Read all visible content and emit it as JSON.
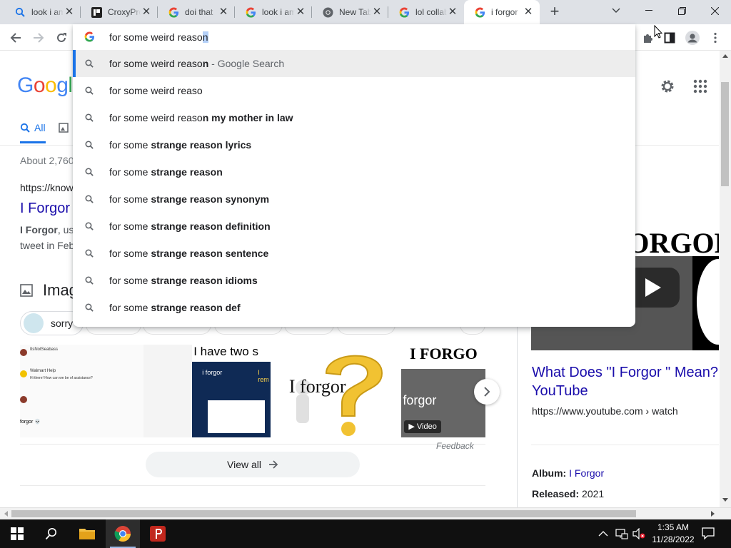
{
  "tabs": [
    {
      "title": "look i am",
      "icon": "google-search-icon",
      "active": false
    },
    {
      "title": "CroxyProxy",
      "icon": "croxyproxy-icon",
      "active": false
    },
    {
      "title": "doi that",
      "icon": "google-g-icon",
      "active": false
    },
    {
      "title": "look i am",
      "icon": "google-g-icon",
      "active": false
    },
    {
      "title": "New Tab",
      "icon": "chrome-icon",
      "active": false
    },
    {
      "title": "lol collab",
      "icon": "google-g-icon",
      "active": false
    },
    {
      "title": "i forgor",
      "icon": "google-g-icon",
      "active": true
    }
  ],
  "omnibox": {
    "typed": "for some weird reaso",
    "autocomplete": "n",
    "suggestions": [
      {
        "plain": "for some weird reaso",
        "bold": "n",
        "rest": "",
        "suffix": " - Google Search",
        "selected": true
      },
      {
        "plain": "for some weird reaso",
        "bold": "",
        "rest": "",
        "suffix": "",
        "selected": false
      },
      {
        "plain": "for some weird reaso",
        "bold": "n my mother in law",
        "rest": "",
        "suffix": "",
        "selected": false
      },
      {
        "plain": "for some ",
        "bold": "strange r",
        "rest": "eason lyrics",
        "suffix": "",
        "selected": false,
        "boldRest": true
      },
      {
        "plain": "for some ",
        "bold": "strange r",
        "rest": "eason",
        "suffix": "",
        "selected": false,
        "boldRest": true
      },
      {
        "plain": "for some ",
        "bold": "strange r",
        "rest": "eason synonym",
        "suffix": "",
        "selected": false,
        "boldRest": true
      },
      {
        "plain": "for some ",
        "bold": "strange r",
        "rest": "eason definition",
        "suffix": "",
        "selected": false,
        "boldRest": true
      },
      {
        "plain": "for some ",
        "bold": "strange r",
        "rest": "eason sentence",
        "suffix": "",
        "selected": false,
        "boldRest": true
      },
      {
        "plain": "for some ",
        "bold": "strange r",
        "rest": "eason idioms",
        "suffix": "",
        "selected": false,
        "boldRest": true
      },
      {
        "plain": "for some ",
        "bold": "strange r",
        "rest": "eason def",
        "suffix": "",
        "selected": false,
        "boldRest": true
      }
    ]
  },
  "page": {
    "logo_visible": "Googl",
    "nav_all": "All",
    "result_stats": "About 2,760",
    "result_cite": "https://know",
    "result_title": "I Forgor",
    "snippet_line1_bold": "I Forgor",
    "snippet_line1": ", us",
    "snippet_line2": "tweet in Feb",
    "images_heading": "Imag",
    "chip_label": "sorry",
    "thumb_texts": [
      "ItsNotSeabass",
      "I have two s",
      "I forgor",
      "I FORGO",
      "forgor",
      "Video",
      "i forgor",
      "I rem"
    ],
    "thumb_tweet_lines": [
      "Walmart Help",
      "Hi there! How can we be of assistance?",
      "forgor 💀"
    ],
    "feedback": "Feedback",
    "view_all": "View all",
    "right": {
      "video_text": "FORGOR",
      "title": "What Does \"I Forgor \" Mean? YouTube",
      "cite": "https://www.youtube.com › watch",
      "album_label": "Album:",
      "album_value": "I Forgor",
      "released_label": "Released:",
      "released_value": "2021"
    }
  },
  "taskbar": {
    "time": "1:35 AM",
    "date": "11/28/2022"
  },
  "colors": {
    "accent": "#1a73e8",
    "link": "#1a0dab",
    "tabstrip": "#dee1e6",
    "taskbar": "#101010"
  }
}
